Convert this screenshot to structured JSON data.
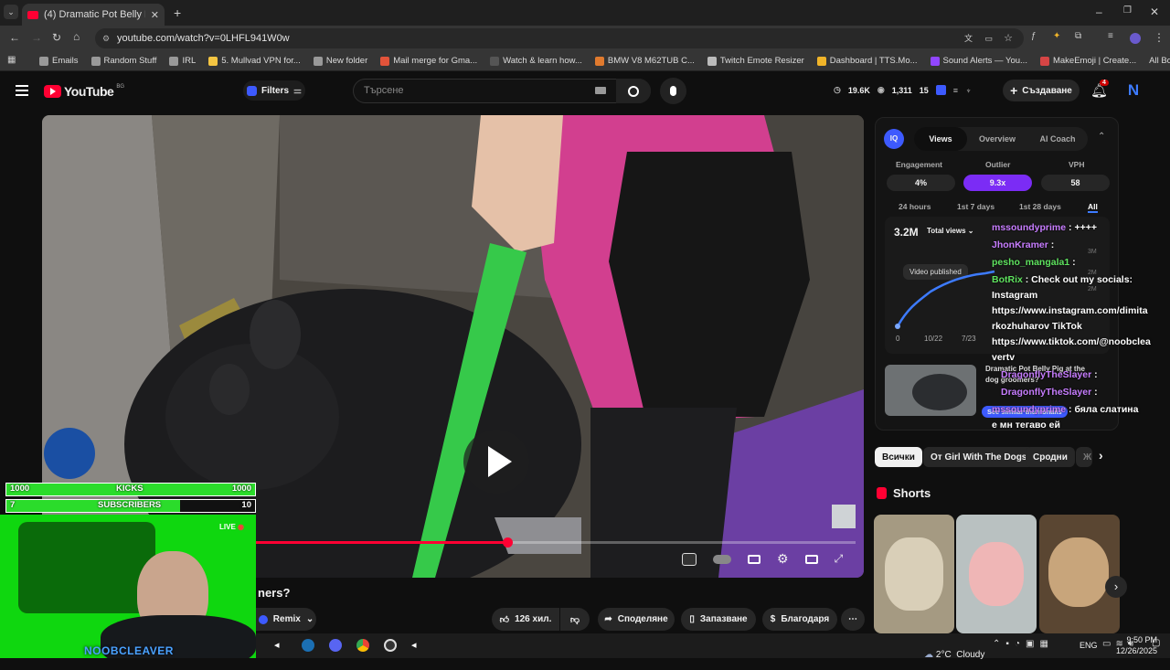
{
  "browser": {
    "tab_title": "(4) Dramatic Pot Belly Pig at t",
    "url": "youtube.com/watch?v=0LHFL941W0w",
    "bookmarks": [
      {
        "label": "Emails",
        "color": "#999"
      },
      {
        "label": "Random Stuff",
        "color": "#999"
      },
      {
        "label": "IRL",
        "color": "#999"
      },
      {
        "label": "5. Mullvad VPN for...",
        "color": "#f4c542"
      },
      {
        "label": "New folder",
        "color": "#999"
      },
      {
        "label": "Mail merge for Gma...",
        "color": "#e2533a"
      },
      {
        "label": "Watch & learn how...",
        "color": "#555"
      },
      {
        "label": "BMW V8 M62TUB C...",
        "color": "#e07a2e"
      },
      {
        "label": "Twitch Emote Resizer",
        "color": "#bbb"
      },
      {
        "label": "Dashboard | TTS.Mo...",
        "color": "#f0b429"
      },
      {
        "label": "Sound Alerts — You...",
        "color": "#9146ff"
      },
      {
        "label": "MakeEmoji | Create...",
        "color": "#d64545"
      }
    ],
    "all_bookmarks": "All Bookmarks"
  },
  "youtube": {
    "logo_text": "YouTube",
    "logo_sup": "BG",
    "filters": "Filters",
    "search_placeholder": "Търсене",
    "stats": {
      "views": "19.6K",
      "watching": "1,311",
      "count": "15"
    },
    "create": "Създаване",
    "notif_count": "4",
    "avatar": "N"
  },
  "panel": {
    "tabs": [
      "Views",
      "Overview",
      "AI Coach"
    ],
    "metric_labels": [
      "Engagement",
      "Outlier",
      "VPH"
    ],
    "metric_values": [
      "4%",
      "9.3x",
      "58"
    ],
    "ranges": [
      "24 hours",
      "1st 7 days",
      "1st 28 days",
      "All"
    ],
    "total": "3.2M",
    "total_select": "Total views",
    "tooltip": "Video published",
    "chart_xticks": [
      "0",
      "10/22",
      "7/23"
    ],
    "chart_yticks": [
      "3M",
      "2M",
      "2M"
    ],
    "video_title_a": "Dramatic Pot Belly Pig at the",
    "video_title_b": "dog groomers?",
    "similar": "See similar thumbnails"
  },
  "chat": [
    {
      "user": "mssoundyprime",
      "text": ": ++++",
      "color": "#c77dff"
    },
    {
      "user": "JhonKramer",
      "text": ":",
      "color": "#c77dff"
    },
    {
      "user": "pesho_mangala1",
      "text": ":",
      "color": "#5fe35f"
    },
    {
      "user": "BotRix",
      "text": ": Check out my socials:",
      "color": "#5fe35f"
    },
    {
      "user": "",
      "text": "Instagram",
      "color": "#fff"
    },
    {
      "user": "",
      "text": "https://www.instagram.com/dimita",
      "color": "#fff"
    },
    {
      "user": "",
      "text": "rkozhuharov TikTok",
      "color": "#fff"
    },
    {
      "user": "",
      "text": "https://www.tiktok.com/@noobclea",
      "color": "#fff"
    },
    {
      "user": "",
      "text": "vertv",
      "color": "#fff"
    },
    {
      "user": "DragonflyTheSlayer",
      "text": ":",
      "color": "#c77dff"
    },
    {
      "user": "DragonflyTheSlayer",
      "text": ":",
      "color": "#c77dff"
    },
    {
      "user": "mssoundyprime",
      "text": ": бяла слатина",
      "color": "#c77dff"
    },
    {
      "user": "",
      "text": "е мн тегаво ей",
      "color": "#fff"
    }
  ],
  "chips": [
    "Всички",
    "От Girl With The Dogs",
    "Сродни",
    "Ж"
  ],
  "shorts_label": "Shorts",
  "stream": {
    "kicks_left": "1000",
    "kicks_label": "KICKS",
    "kicks_right": "1000",
    "subs_left": "7",
    "subs_label": "SUBSCRIBERS",
    "subs_right": "10",
    "subs_progress": 0.7,
    "live": "LIVE",
    "streamer": "NOOBCLEAVER"
  },
  "video_title_fragment": "ners?",
  "remix": "Remix",
  "actions": {
    "like": "126 хил.",
    "share": "Споделяне",
    "save": "Запазване",
    "thanks": "Благодаря"
  },
  "taskbar": {
    "weather": "2°C  Cloudy",
    "lang": "ENG",
    "time": "9:50 PM",
    "date": "12/26/2025"
  }
}
